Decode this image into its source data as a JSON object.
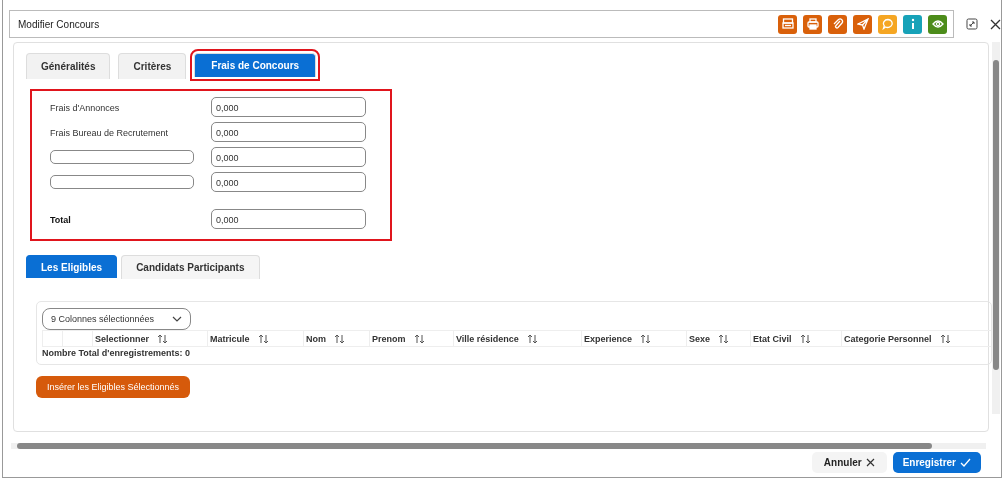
{
  "window": {
    "title": "Modifier Concours"
  },
  "toolbar": [
    {
      "kind": "print-card",
      "color": "#d9600a"
    },
    {
      "kind": "print",
      "color": "#d9600a"
    },
    {
      "kind": "clip",
      "color": "#d9600a"
    },
    {
      "kind": "send",
      "color": "#d9600a"
    },
    {
      "kind": "chat",
      "color": "#f5a623"
    },
    {
      "kind": "info",
      "color": "#17a2b8"
    },
    {
      "kind": "eye",
      "color": "#4c8c1a"
    }
  ],
  "tabs": [
    {
      "label": "Généralités",
      "selected": false,
      "highlighted": false
    },
    {
      "label": "Critères",
      "selected": false,
      "highlighted": false
    },
    {
      "label": "Frais de Concours",
      "selected": true,
      "highlighted": true
    }
  ],
  "fees": {
    "highlighted": true,
    "rows": [
      {
        "kind": "label",
        "label": "Frais d'Annonces",
        "value": "0,000"
      },
      {
        "kind": "label",
        "label": "Frais Bureau de Recrutement",
        "value": "0,000"
      },
      {
        "kind": "input",
        "value": "0,000"
      },
      {
        "kind": "input",
        "value": "0,000"
      },
      {
        "kind": "total",
        "label": "Total",
        "value": "0,000"
      }
    ]
  },
  "subtabs": [
    {
      "label": "Les Eligibles",
      "selected": true
    },
    {
      "label": "Candidats Participants",
      "selected": false
    }
  ],
  "table": {
    "column_picker": "9 Colonnes sélectionnées",
    "columns": [
      "Selectionner",
      "Matricule",
      "Nom",
      "Prenom",
      "Ville résidence",
      "Experience",
      "Sexe",
      "Etat Civil",
      "Categorie Personnel"
    ],
    "footer": "Nombre Total d'enregistrements: 0"
  },
  "insert_button": "Insérer les Eligibles Sélectionnés",
  "buttons": [
    {
      "kind": "cancel",
      "label": "Annuler"
    },
    {
      "kind": "save",
      "label": "Enregistrer"
    }
  ]
}
